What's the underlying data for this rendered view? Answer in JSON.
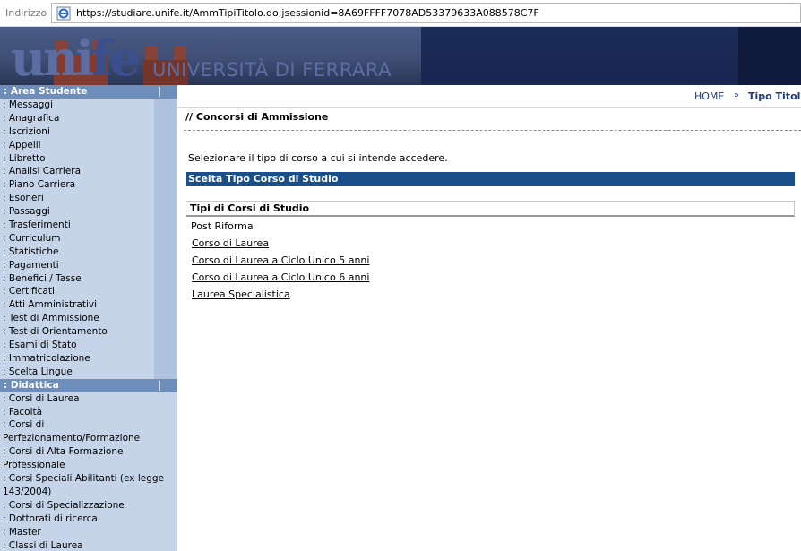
{
  "addressbar": {
    "label": "Indirizzo",
    "url": "https://studiare.unife.it/AmmTipiTitolo.do;jsessionid=8A69FFFF7078AD53379633A088578C7F"
  },
  "header": {
    "logo_part1": "uni",
    "logo_part2": "fe",
    "university_name": "UNIVERSITÀ DI FERRARA"
  },
  "breadcrumb": {
    "home": "HOME",
    "separator": "»",
    "current": "Tipo Titolo"
  },
  "sidebar": {
    "area_studente": {
      "title": ": Area Studente",
      "items": [
        ": Messaggi",
        ": Anagrafica",
        ": Iscrizioni",
        ": Appelli",
        ": Libretto",
        ": Analisi Carriera",
        ": Piano Carriera",
        ": Esoneri",
        ": Passaggi",
        ": Trasferimenti",
        ": Curriculum",
        ": Statistiche",
        ": Pagamenti",
        ": Benefici / Tasse",
        ": Certificati",
        ": Atti Amministrativi",
        ": Test di Ammissione",
        ": Test di Orientamento",
        ": Esami di Stato",
        ": Immatricolazione",
        ": Scelta Lingue"
      ]
    },
    "didattica": {
      "title": ": Didattica",
      "items": [
        ": Corsi di Laurea",
        ": Facoltà",
        ": Corsi di Perfezionamento/Formazione",
        ": Corsi di Alta Formazione Professionale",
        ": Corsi Speciali Abilitanti (ex legge 143/2004)",
        ": Corsi di Specializzazione",
        ": Dottorati di ricerca",
        ": Master",
        ": Classi di Laurea"
      ]
    }
  },
  "main": {
    "title": "// Concorsi di Ammissione",
    "instruction": "Selezionare il tipo di corso a cui si intende accedere.",
    "section_bar": "Scelta Tipo Corso di Studio",
    "table_header": "Tipi di Corsi di Studio",
    "group_label": "Post Riforma",
    "courses": [
      "Corso di Laurea",
      "Corso di Laurea a Ciclo Unico 5 anni",
      "Corso di Laurea a Ciclo Unico 6 anni",
      "Laurea Specialistica"
    ]
  },
  "colors": {
    "sidebar_bg": "#c5d4e8",
    "sidebar_head": "#6d8dba",
    "section_bar": "#1a4f8a",
    "header_bg": "#1b2c58"
  }
}
